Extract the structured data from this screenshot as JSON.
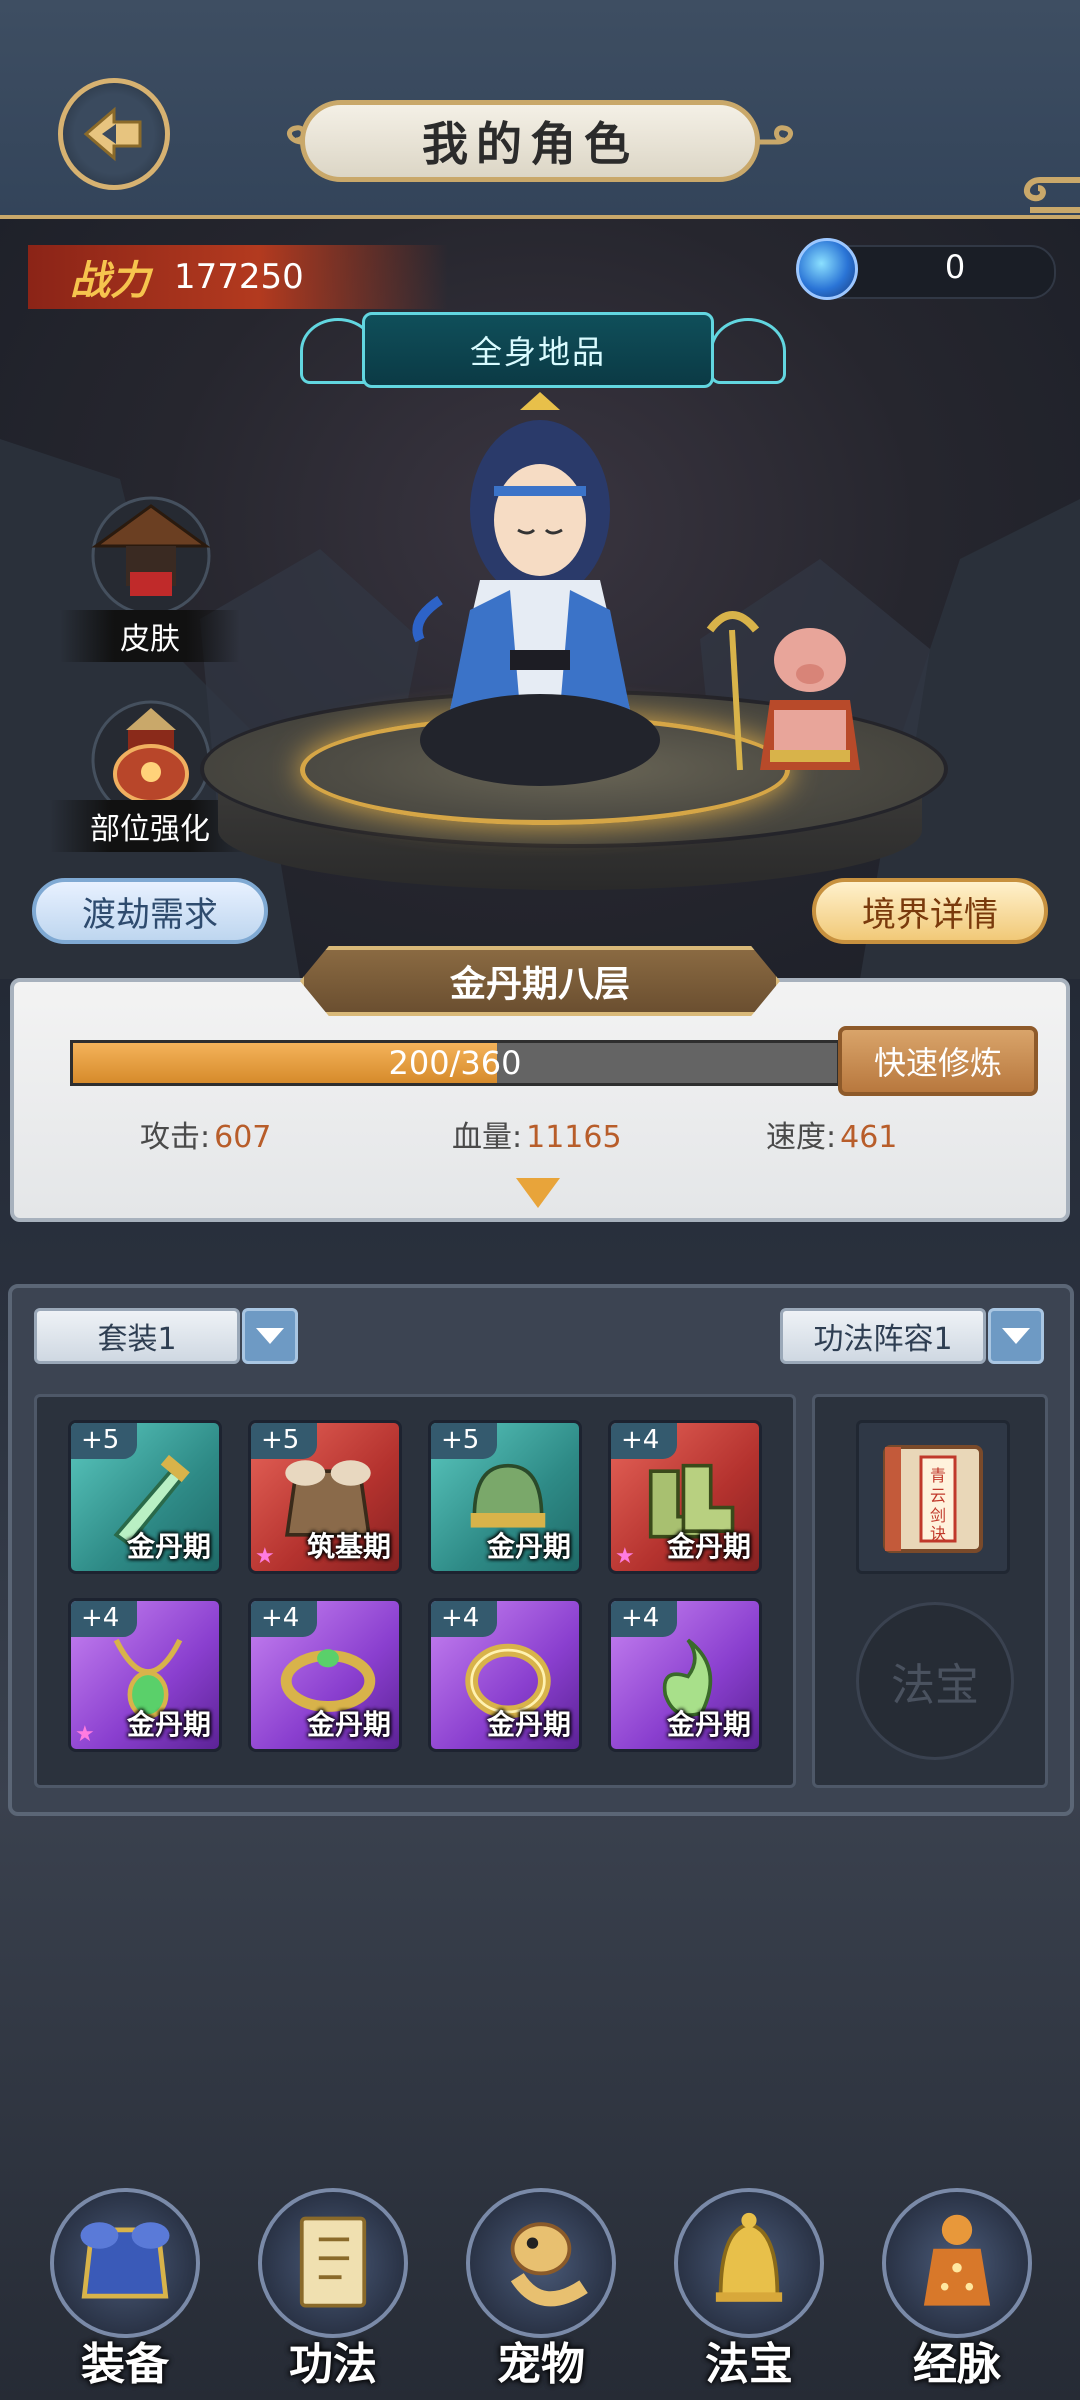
{
  "header": {
    "title": "我的角色"
  },
  "status": {
    "power_label": "战力",
    "power_value": "177250",
    "currency_value": "0"
  },
  "character": {
    "quality_badge": "全身地品",
    "skin_label": "皮肤",
    "enhance_label": "部位强化"
  },
  "actions": {
    "tribulation_label": "渡劫需求",
    "realm_detail_label": "境界详情"
  },
  "realm": {
    "name": "金丹期八层",
    "exp_text": "200/360",
    "exp_current": 200,
    "exp_max": 360,
    "quick_train_label": "快速修炼",
    "stats": [
      {
        "label": "攻击:",
        "value": "607"
      },
      {
        "label": "血量:",
        "value": "11165"
      },
      {
        "label": "速度:",
        "value": "461"
      }
    ]
  },
  "equipment": {
    "set_dropdown": "套装1",
    "skill_dropdown": "功法阵容1",
    "slots": [
      {
        "plus": "+5",
        "tier": "金丹期",
        "rarity": "teal",
        "icon": "sword-icon",
        "star": false
      },
      {
        "plus": "+5",
        "tier": "筑基期",
        "rarity": "red",
        "icon": "armor-icon",
        "star": true
      },
      {
        "plus": "+5",
        "tier": "金丹期",
        "rarity": "teal",
        "icon": "helmet-icon",
        "star": false
      },
      {
        "plus": "+4",
        "tier": "金丹期",
        "rarity": "red",
        "icon": "boots-icon",
        "star": true
      },
      {
        "plus": "+4",
        "tier": "金丹期",
        "rarity": "purple",
        "icon": "necklace-icon",
        "star": true
      },
      {
        "plus": "+4",
        "tier": "金丹期",
        "rarity": "purple",
        "icon": "bracelet-icon",
        "star": false
      },
      {
        "plus": "+4",
        "tier": "金丹期",
        "rarity": "purple",
        "icon": "ring-icon",
        "star": false
      },
      {
        "plus": "+4",
        "tier": "金丹期",
        "rarity": "purple",
        "icon": "jade-pendant-icon",
        "star": false
      }
    ],
    "book_title": "青云剑诀",
    "treasure_slot_label": "法宝"
  },
  "nav": [
    {
      "label": "装备",
      "icon": "armor-icon"
    },
    {
      "label": "功法",
      "icon": "scroll-book-icon"
    },
    {
      "label": "宠物",
      "icon": "dragon-pet-icon"
    },
    {
      "label": "法宝",
      "icon": "golden-bell-icon"
    },
    {
      "label": "经脉",
      "icon": "meridian-figure-icon"
    }
  ],
  "colors": {
    "accent_gold": "#c9a86a",
    "exp_fill": "#e39a3a",
    "teal_rarity": "#2e8a86",
    "red_rarity": "#b4322e",
    "purple_rarity": "#8a3fcf"
  }
}
